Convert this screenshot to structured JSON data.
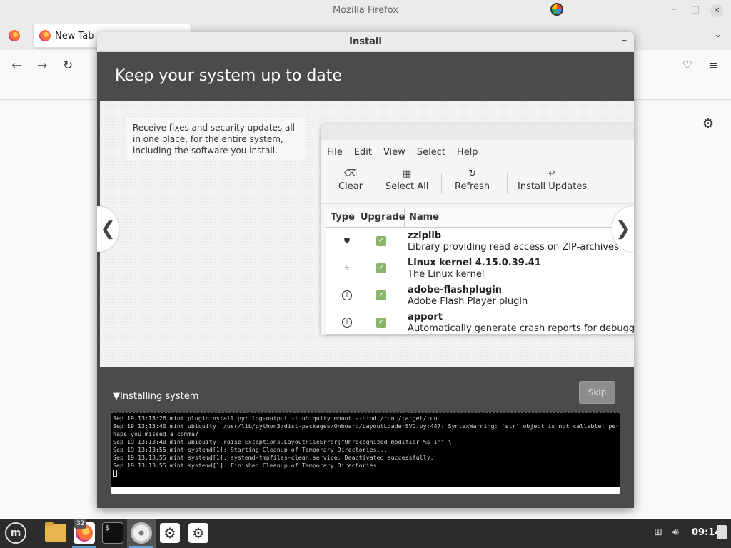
{
  "firefox": {
    "window_title": "Mozilla Firefox",
    "tab_label": "New Tab",
    "controls": {
      "minimize": "–",
      "maximize": "□",
      "close": "✕"
    },
    "nav_icons": [
      "back-arrow-icon",
      "forward-arrow-icon",
      "reload-icon",
      "pocket-icon",
      "hamburger-menu-icon",
      "settings-gear-icon"
    ]
  },
  "install_dialog": {
    "title": "Install",
    "minimize": "–",
    "heading": "Keep your system up to date",
    "slide_text": "Receive fixes and security updates all in one place, for the entire system, including the software you install.",
    "update_manager": {
      "menu": [
        "File",
        "Edit",
        "View",
        "Select",
        "Help"
      ],
      "toolbar": [
        {
          "icon": "⌫",
          "label": "Clear"
        },
        {
          "icon": "▦",
          "label": "Select All"
        },
        {
          "icon": "↻",
          "label": "Refresh"
        },
        {
          "icon": "↵",
          "label": "Install Updates"
        }
      ],
      "columns": [
        "Type",
        "Upgrade",
        "Name"
      ],
      "rows": [
        {
          "type_icon": "shield",
          "checked": true,
          "name": "zziplib",
          "description": "Library providing read access on ZIP-archives - library"
        },
        {
          "type_icon": "lightning",
          "checked": true,
          "name": "Linux kernel 4.15.0.39.41",
          "description": "The Linux kernel"
        },
        {
          "type_icon": "arrow-up",
          "checked": true,
          "name": "adobe-flashplugin",
          "description": "Adobe Flash Player plugin"
        },
        {
          "type_icon": "arrow-up",
          "checked": true,
          "name": "apport",
          "description": "Automatically generate crash reports for debugging"
        }
      ]
    },
    "prev_arrow": "❮",
    "next_arrow": "❯",
    "progress": {
      "label": "Installing system",
      "skip_label": "Skip",
      "terminal_lines": [
        "Sep 19 13:13:26 mint plugininstall.py: log-output -t ubiquity mount --bind /run /target/run",
        "Sep 19 13:13:40 mint ubiquity: /usr/lib/python3/dist-packages/Onboard/LayoutLoaderSVG.py:447: SyntaxWarning: 'str' object is not callable; per",
        "haps you missed a comma?",
        "Sep 19 13:13:40 mint ubiquity:   raise Exceptions.LayoutFileError(\"Unrecognized modifier %s in\" \\",
        "Sep 19 13:13:55 mint systemd[1]: Starting Cleanup of Temporary Directories...",
        "Sep 19 13:13:55 mint systemd[1]: systemd-tmpfiles-clean.service: Deactivated successfully.",
        "Sep 19 13:13:55 mint systemd[1]: Finished Cleanup of Temporary Directories."
      ]
    }
  },
  "taskbar": {
    "menu_letter": "m",
    "firefox_badge": "32",
    "terminal_glyph": "$_",
    "clock": "09:14"
  }
}
